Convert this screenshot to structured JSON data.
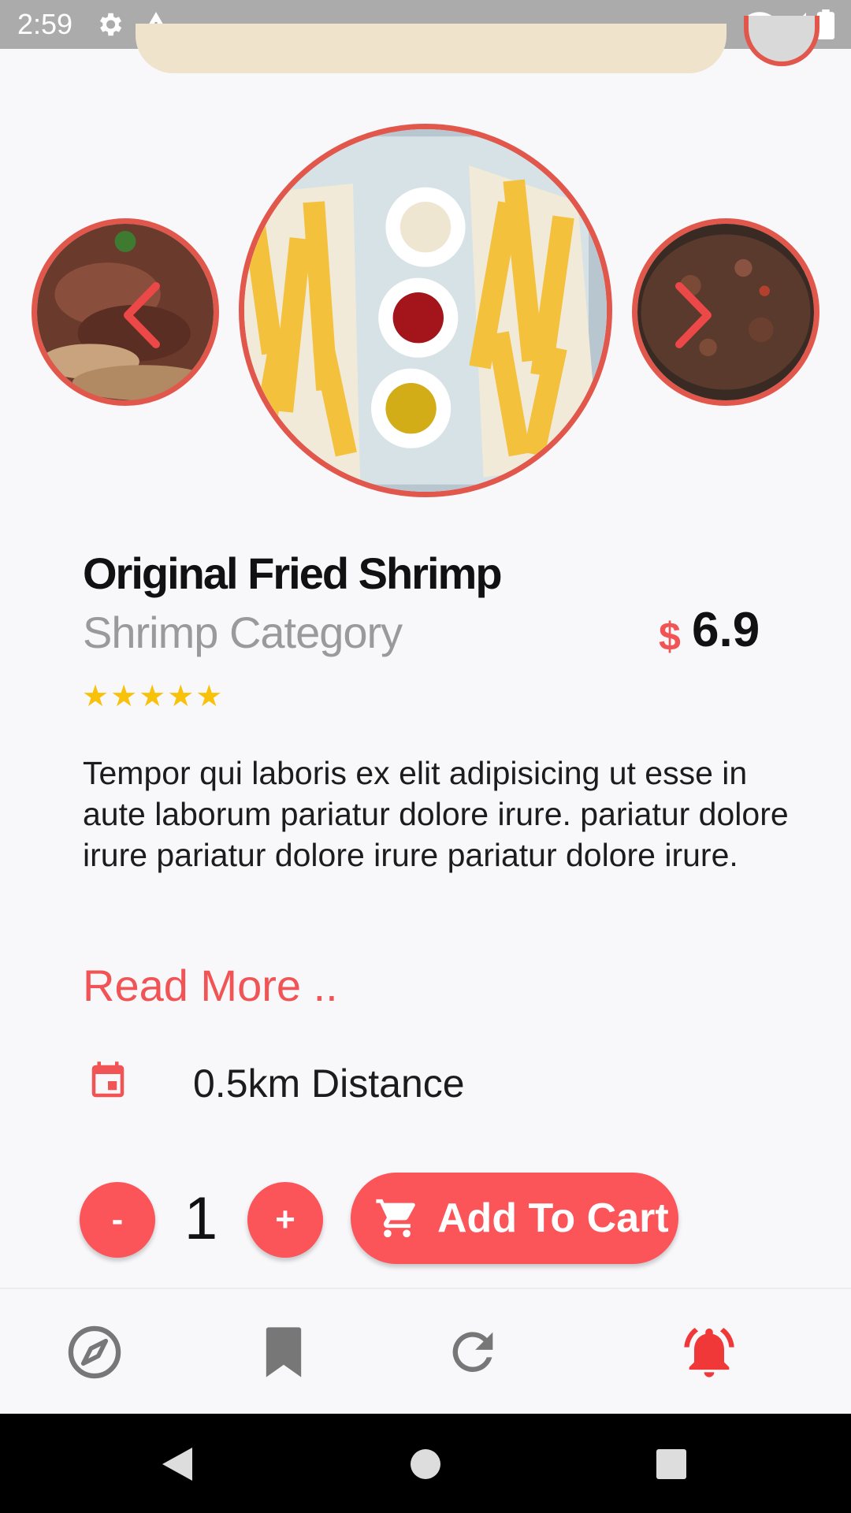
{
  "status_bar": {
    "time": "2:59"
  },
  "product": {
    "title": "Original Fried Shrimp",
    "category": "Shrimp Category",
    "currency": "$",
    "price": "6.9",
    "stars": "★★★★★",
    "rating": 5,
    "description": "Tempor qui laboris ex elit adipisicing ut esse in aute laborum pariatur dolore irure. pariatur dolore irure pariatur dolore irure pariatur dolore irure.",
    "read_more": "Read More ..",
    "distance": "0.5km Distance"
  },
  "cart": {
    "minus": "-",
    "quantity": "1",
    "plus": "+",
    "add_label": "Add To Cart"
  },
  "bottom_nav": {
    "items": [
      "compass-icon",
      "bookmark-icon",
      "refresh-icon",
      "notification-bell-icon"
    ],
    "active": "notification-bell-icon"
  },
  "colors": {
    "accent": "#fb5459",
    "ring": "#e2574c",
    "star": "#f8c20a"
  }
}
